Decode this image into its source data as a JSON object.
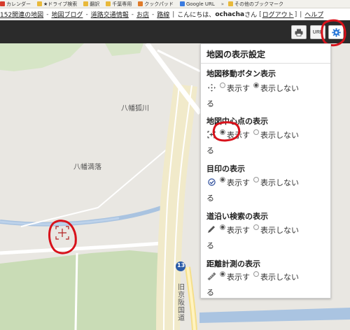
{
  "bookmarks": [
    {
      "label": "カレンダー",
      "icon": "calendar-icon",
      "color": "#d63b2b"
    },
    {
      "label": "★ドライブ検索",
      "icon": "folder-icon",
      "color": "#e8b93a"
    },
    {
      "label": "翻訳",
      "icon": "folder-icon",
      "color": "#e8b93a"
    },
    {
      "label": "千葉専用",
      "icon": "folder-icon",
      "color": "#e8b93a"
    },
    {
      "label": "クックパッド",
      "icon": "cookpad-icon",
      "color": "#e07b2a"
    },
    {
      "label": "Google URL",
      "icon": "google-icon",
      "color": "#3a7be0"
    },
    {
      "label": "その他のブックマーク",
      "icon": "folder-icon",
      "color": "#e8b93a"
    }
  ],
  "topnav": {
    "link1": "152関連の地図",
    "link2": "地図ブログ",
    "link3": "道路交通情報",
    "link4": "お店",
    "link5": "路線",
    "greeting_pre": "こんにちは、",
    "username": "ochacha",
    "greeting_post": "さん",
    "logout": "ログアウト",
    "help": "ヘルプ"
  },
  "toolbar": {
    "print_icon": "printer-icon",
    "url_label": "URL",
    "settings_icon": "gear-icon",
    "accent": "#2f7bd9"
  },
  "map": {
    "labels": [
      "八幡狐川",
      "八幡満落"
    ],
    "route_number": "13",
    "road_name": "旧京阪国道"
  },
  "panel": {
    "title": "地図の表示設定",
    "sections": [
      {
        "title": "地図移動ボタン表示",
        "icon": "move-arrows-icon",
        "show": "表示す",
        "show_cont": "る",
        "hide": "表示しない",
        "selected": "hide"
      },
      {
        "title": "地図中心点の表示",
        "icon": "crosshair-icon",
        "show": "表示す",
        "show_cont": "る",
        "hide": "表示しない",
        "selected": "show"
      },
      {
        "title": "目印の表示",
        "icon": "check-circle-icon",
        "show": "表示す",
        "show_cont": "る",
        "hide": "表示しない",
        "selected": "show"
      },
      {
        "title": "道沿い検索の表示",
        "icon": "pencil-icon",
        "show": "表示す",
        "show_cont": "る",
        "hide": "表示しない",
        "selected": "show"
      },
      {
        "title": "距離計測の表示",
        "icon": "ruler-icon",
        "show": "表示す",
        "show_cont": "る",
        "hide": "表示しない",
        "selected": "show"
      }
    ]
  },
  "annotation_color": "#d8121b"
}
